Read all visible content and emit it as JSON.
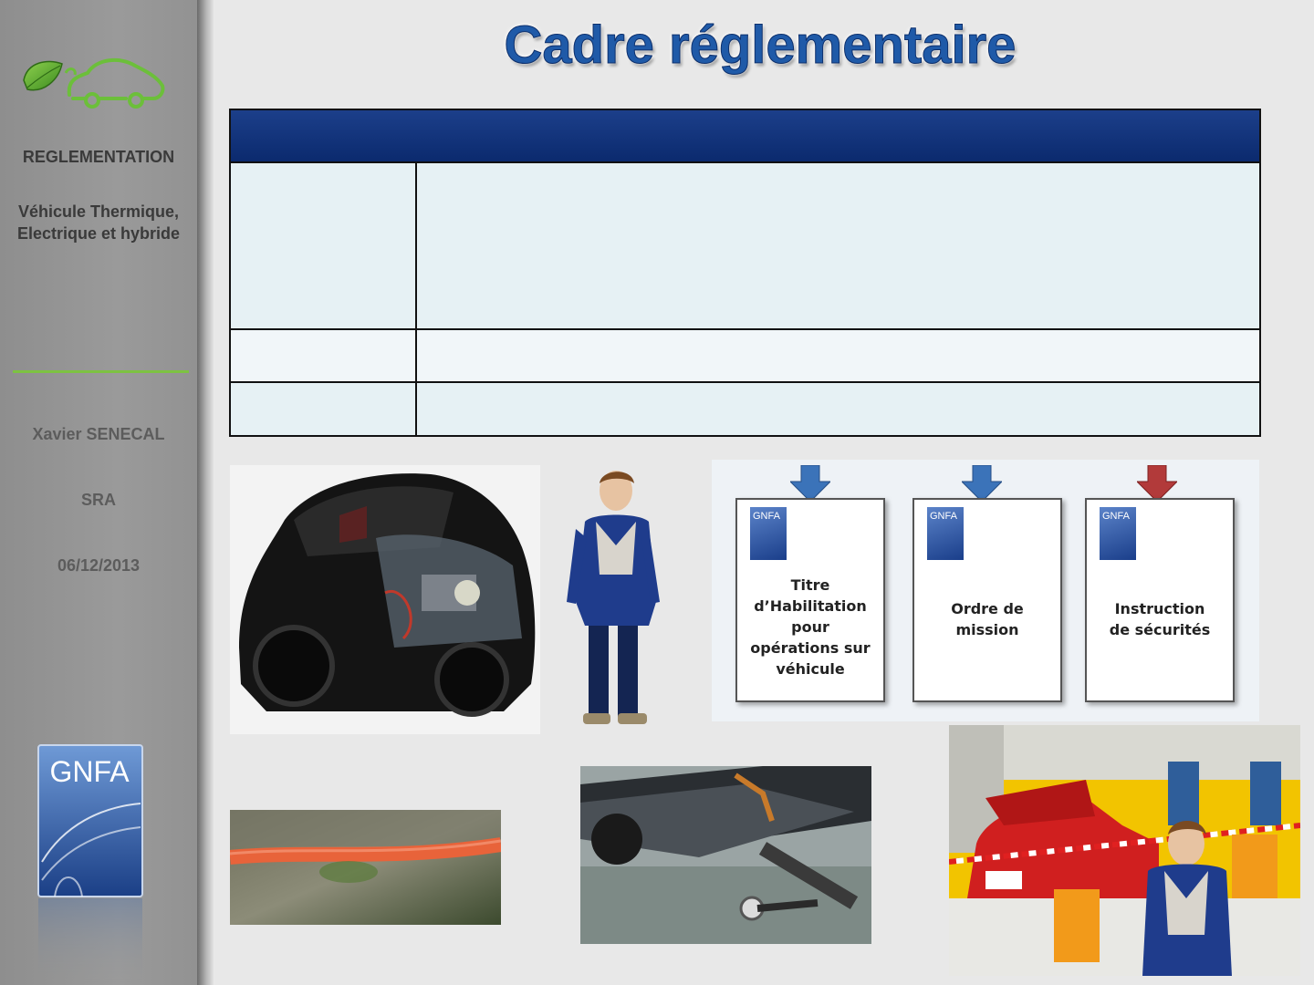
{
  "sidebar": {
    "section_title": "REGLEMENTATION",
    "subtitle_line1": "Véhicule Thermique,",
    "subtitle_line2": "Electrique et hybride",
    "author": "Xavier SENECAL",
    "org": "SRA",
    "date": "06/12/2013",
    "logo_text": "GNFA",
    "accent_color": "#7dc242"
  },
  "title": "Cadre réglementaire",
  "table": {
    "header_color": "#0b2a6e",
    "rows": [
      {
        "label": "",
        "content": ""
      },
      {
        "label": "",
        "content": ""
      },
      {
        "label": "",
        "content": ""
      }
    ]
  },
  "documents": [
    {
      "logo": "GNFA",
      "title": "Titre d’Habilitation pour opérations sur véhicule",
      "arrow_color": "#3b73b9"
    },
    {
      "logo": "GNFA",
      "title": "Ordre de mission",
      "arrow_color": "#3b73b9"
    },
    {
      "logo": "GNFA",
      "title": "Instruction de sécurités",
      "arrow_color": "#b23a3a"
    }
  ],
  "images": {
    "car": "hybrid-car-cutaway-photo",
    "technician": "technician-figure",
    "cable": "orange-high-voltage-cable-photo",
    "underbody": "vehicle-underbody-battery-photo",
    "garage": "workshop-safety-zone-illustration"
  }
}
